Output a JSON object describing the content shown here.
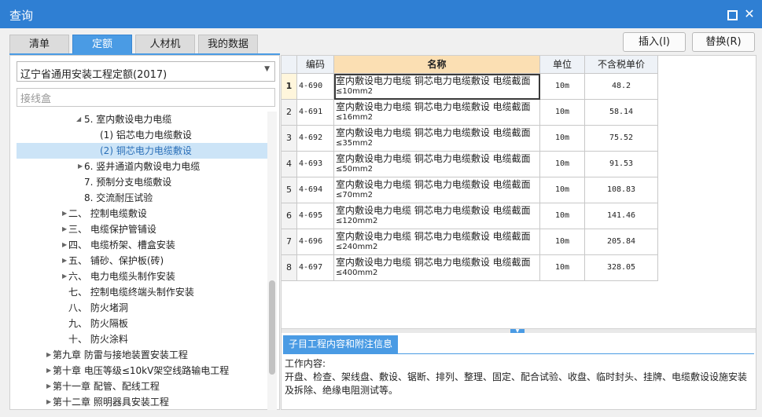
{
  "window": {
    "title": "查询"
  },
  "tabs": [
    {
      "label": "清单",
      "active": false
    },
    {
      "label": "定额",
      "active": true
    },
    {
      "label": "人材机",
      "active": false
    },
    {
      "label": "我的数据",
      "active": false
    }
  ],
  "actions": {
    "insert": "插入(I)",
    "replace": "替换(R)"
  },
  "left": {
    "quota_library": "辽宁省通用安装工程定额(2017)",
    "search_value": "接线盒",
    "tree": [
      {
        "label": "5. 室内敷设电力电缆",
        "expander": "expanded"
      },
      {
        "label": "(1) 铝芯电力电缆敷设",
        "expander": "none"
      },
      {
        "label": "(2) 铜芯电力电缆敷设",
        "expander": "none",
        "selected": true
      },
      {
        "label": "6. 竖井通道内敷设电力电缆",
        "expander": "collapsed"
      },
      {
        "label": "7. 预制分支电缆敷设",
        "expander": "none"
      },
      {
        "label": "8. 交流耐压试验",
        "expander": "none"
      },
      {
        "label": "二、 控制电缆敷设",
        "expander": "collapsed"
      },
      {
        "label": "三、 电缆保护管铺设",
        "expander": "collapsed"
      },
      {
        "label": "四、 电缆桥架、槽盒安装",
        "expander": "collapsed"
      },
      {
        "label": "五、 铺砂、保护板(砖)",
        "expander": "collapsed"
      },
      {
        "label": "六、 电力电缆头制作安装",
        "expander": "collapsed"
      },
      {
        "label": "七、 控制电缆终端头制作安装",
        "expander": "none"
      },
      {
        "label": "八、 防火堵洞",
        "expander": "none"
      },
      {
        "label": "九、 防火隔板",
        "expander": "none"
      },
      {
        "label": "十、 防火涂料",
        "expander": "none"
      },
      {
        "label": "第九章 防雷与接地装置安装工程",
        "expander": "collapsed"
      },
      {
        "label": "第十章 电压等级≤10kV架空线路输电工程",
        "expander": "collapsed"
      },
      {
        "label": "第十一章 配管、配线工程",
        "expander": "collapsed"
      },
      {
        "label": "第十二章 照明器具安装工程",
        "expander": "collapsed"
      }
    ]
  },
  "grid": {
    "columns": {
      "code": "编码",
      "name": "名称",
      "unit": "单位",
      "price": "不含税单价"
    },
    "rows": [
      {
        "no": "1",
        "code": "4-690",
        "name_a": "室内敷设电力电缆 铜芯电力电缆敷设 电缆截面",
        "name_b": "≤10mm2",
        "unit": "10m",
        "price": "48.2",
        "current": true
      },
      {
        "no": "2",
        "code": "4-691",
        "name_a": "室内敷设电力电缆 铜芯电力电缆敷设 电缆截面",
        "name_b": "≤16mm2",
        "unit": "10m",
        "price": "58.14"
      },
      {
        "no": "3",
        "code": "4-692",
        "name_a": "室内敷设电力电缆 铜芯电力电缆敷设 电缆截面",
        "name_b": "≤35mm2",
        "unit": "10m",
        "price": "75.52"
      },
      {
        "no": "4",
        "code": "4-693",
        "name_a": "室内敷设电力电缆 铜芯电力电缆敷设 电缆截面",
        "name_b": "≤50mm2",
        "unit": "10m",
        "price": "91.53"
      },
      {
        "no": "5",
        "code": "4-694",
        "name_a": "室内敷设电力电缆 铜芯电力电缆敷设 电缆截面",
        "name_b": "≤70mm2",
        "unit": "10m",
        "price": "108.83"
      },
      {
        "no": "6",
        "code": "4-695",
        "name_a": "室内敷设电力电缆 铜芯电力电缆敷设 电缆截面",
        "name_b": "≤120mm2",
        "unit": "10m",
        "price": "141.46"
      },
      {
        "no": "7",
        "code": "4-696",
        "name_a": "室内敷设电力电缆 铜芯电力电缆敷设 电缆截面",
        "name_b": "≤240mm2",
        "unit": "10m",
        "price": "205.84"
      },
      {
        "no": "8",
        "code": "4-697",
        "name_a": "室内敷设电力电缆 铜芯电力电缆敷设 电缆截面",
        "name_b": "≤400mm2",
        "unit": "10m",
        "price": "328.05"
      }
    ]
  },
  "info": {
    "tab_label": "子目工程内容和附注信息",
    "heading": "工作内容:",
    "line1": "开盘、检查、架线盘、敷设、锯断、排列、整理、固定、配合试验、收盘、临时封头、挂牌、电缆敷设设施安装",
    "line2": "及拆除、绝缘电阻测试等。"
  }
}
